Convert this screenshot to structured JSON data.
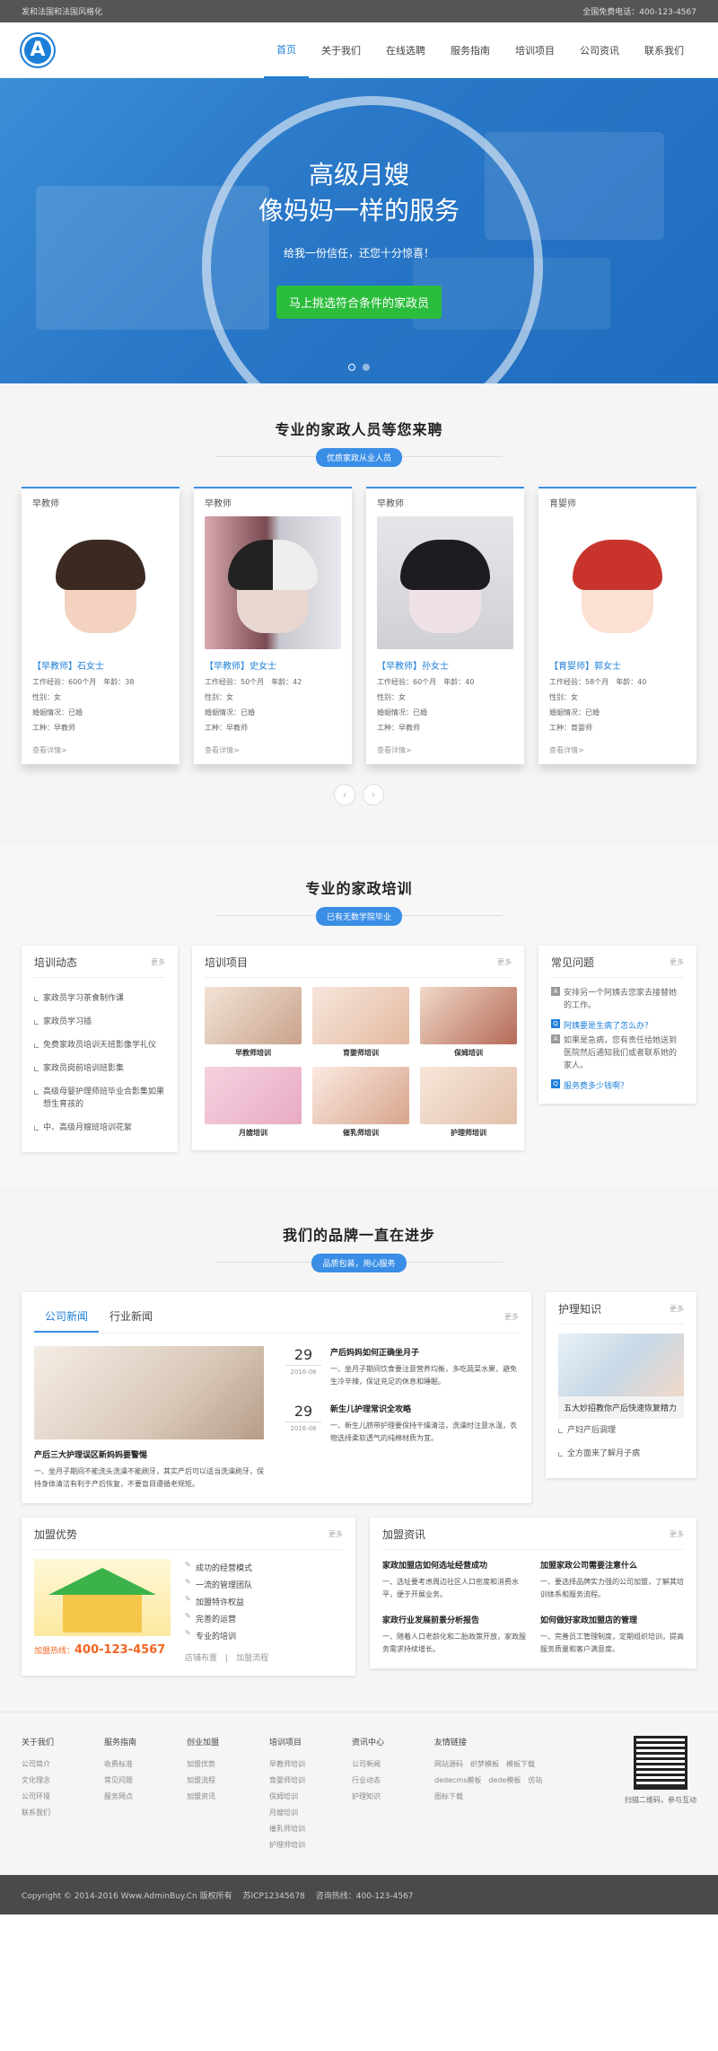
{
  "topbar": {
    "left": "发和法国和法国风格化",
    "right": "全国免费电话：400-123-4567"
  },
  "logo": {
    "letter": "A"
  },
  "nav": [
    "首页",
    "关于我们",
    "在线选聘",
    "服务指南",
    "培训项目",
    "公司资讯",
    "联系我们"
  ],
  "hero": {
    "title1": "高级月嫂",
    "title2": "像妈妈一样的服务",
    "subtitle": "给我一份信任，还您十分惊喜！",
    "button": "马上挑选符合条件的家政员"
  },
  "staff": {
    "title": "专业的家政人员等您来聘",
    "badge": "优质家政从业人员",
    "cards": [
      {
        "role": "早教师",
        "name": "【早教师】石女士",
        "exp": "工作经验：600个月",
        "age": "年龄：38",
        "sex": "性别：女",
        "marriage": "婚姻情况：已婚",
        "job": "工种：早教师",
        "more": "查看详情>"
      },
      {
        "role": "早教师",
        "name": "【早教师】史女士",
        "exp": "工作经验：50个月",
        "age": "年龄：42",
        "sex": "性别：女",
        "marriage": "婚姻情况：已婚",
        "job": "工种：早教师",
        "more": "查看详情>"
      },
      {
        "role": "早教师",
        "name": "【早教师】孙女士",
        "exp": "工作经验：60个月",
        "age": "年龄：40",
        "sex": "性别：女",
        "marriage": "婚姻情况：已婚",
        "job": "工种：早教师",
        "more": "查看详情>"
      },
      {
        "role": "育婴师",
        "name": "【育婴师】郭女士",
        "exp": "工作经验：58个月",
        "age": "年龄：40",
        "sex": "性别：女",
        "marriage": "婚姻情况：已婚",
        "job": "工种：育婴师",
        "more": "查看详情>"
      }
    ]
  },
  "training": {
    "title": "专业的家政培训",
    "badge": "已有无数学院毕业",
    "more": "更多",
    "news_title": "培训动态",
    "news": [
      "家政员学习茶食制作课",
      "家政员学习插",
      "免费家政员培训天班影像学礼仪",
      "家政员岗前培训班影集",
      "高级母婴护理师班毕业合影集如果想生育孩的",
      "中、高级月嫂班培训花絮"
    ],
    "items_title": "培训项目",
    "items": [
      "早教师培训",
      "育婴师培训",
      "保姆培训",
      "月嫂培训",
      "催乳师培训",
      "护理师培训"
    ],
    "faq_title": "常见问题",
    "faq_intro": "安排另一个阿姨去您家去接替她的工作。",
    "faq": [
      {
        "q": "阿姨要是生病了怎么办？",
        "a": "如果是急病，您有责任给她送到医院然后通知我们或者联系她的家人。"
      },
      {
        "q": "服务费多少钱啊？",
        "a": ""
      }
    ]
  },
  "brand": {
    "title": "我们的品牌一直在进步",
    "badge": "品质包装，用心服务",
    "tabs": [
      "公司新闻",
      "行业新闻"
    ],
    "more": "更多",
    "lead_title": "产后三大护理误区新妈妈要警惕",
    "lead_text": "一、坐月子期间不能洗头洗澡不能刷牙，其实产后可以适当洗澡刷牙，保持身体清洁有利于产后恢复，不要盲目遵循老规矩。",
    "list": [
      {
        "day": "29",
        "ym": "2016-06",
        "title": "产后妈妈如何正确坐月子",
        "text": "一、坐月子期间饮食要注意营养均衡，多吃蔬菜水果，避免生冷辛辣，保证充足的休息和睡眠。"
      },
      {
        "day": "29",
        "ym": "2016-06",
        "title": "新生儿护理常识全攻略",
        "text": "一、新生儿脐带护理要保持干燥清洁，洗澡时注意水温，衣物选择柔软透气的纯棉材质为宜。"
      }
    ],
    "care_title": "护理知识",
    "care_caption": "五大妙招教你产后快速恢复精力",
    "care_list": [
      "产妇产后调理",
      "全方面来了解月子病"
    ]
  },
  "join": {
    "title": "加盟优势",
    "more": "更多",
    "hotline_label": "加盟热线：",
    "hotline": "400-123-4567",
    "items": [
      "成功的经营模式",
      "一流的管理团队",
      "加盟特许权益",
      "完善的运营",
      "专业的培训"
    ],
    "links": [
      "店铺布置",
      "加盟流程"
    ],
    "news_title": "加盟资讯",
    "news": [
      {
        "title": "家政加盟店如何选址经营成功",
        "text": "一、选址要考虑周边社区人口密度和消费水平，便于开展业务。"
      },
      {
        "title": "加盟家政公司需要注意什么",
        "text": "一、要选择品牌实力强的公司加盟，了解其培训体系和服务流程。"
      },
      {
        "title": "家政行业发展前景分析报告",
        "text": "一、随着人口老龄化和二胎政策开放，家政服务需求持续增长。"
      },
      {
        "title": "如何做好家政加盟店的管理",
        "text": "一、完善员工管理制度，定期组织培训，提高服务质量和客户满意度。"
      }
    ]
  },
  "footer": {
    "cols": [
      {
        "head": "关于我们",
        "items": [
          "公司简介",
          "文化理念",
          "公司环境",
          "联系我们"
        ]
      },
      {
        "head": "服务指南",
        "items": [
          "收费标准",
          "常见问题",
          "服务网点"
        ]
      },
      {
        "head": "创业加盟",
        "items": [
          "加盟优势",
          "加盟流程",
          "加盟资讯"
        ]
      },
      {
        "head": "培训项目",
        "items": [
          "早教师培训",
          "育婴师培训",
          "保姆培训",
          "月嫂培训",
          "催乳师培训",
          "护理师培训"
        ]
      },
      {
        "head": "资讯中心",
        "items": [
          "公司新闻",
          "行业动态",
          "护理知识"
        ]
      }
    ],
    "links_head": "友情链接",
    "links": [
      "网站源码",
      "织梦模板",
      "模板下载",
      "dedecms模板",
      "dede模板",
      "仿站",
      "图标下载"
    ],
    "qr_caption": "扫描二维码，参与互动",
    "copyright": "Copyright © 2014-2016 Www.AdminBuy.Cn 版权所有",
    "icp": "苏ICP12345678",
    "hotline": "咨询热线：400-123-4567"
  }
}
